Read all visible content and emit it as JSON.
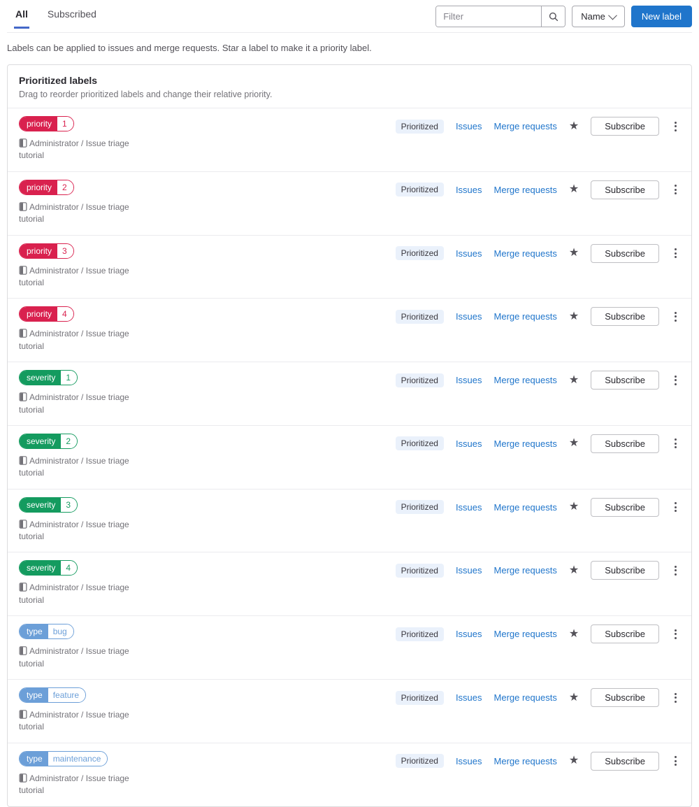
{
  "tabs": {
    "all": "All",
    "subscribed": "Subscribed"
  },
  "toolbar": {
    "filter_placeholder": "Filter",
    "sort_label": "Name",
    "new_label_button": "New label"
  },
  "description": "Labels can be applied to issues and merge requests. Star a label to make it a priority label.",
  "prioritized_card": {
    "title": "Prioritized labels",
    "subtitle": "Drag to reorder prioritized labels and change their relative priority."
  },
  "row_common": {
    "project": "Administrator / Issue triage tutorial",
    "prioritized_badge": "Prioritized",
    "issues_link": "Issues",
    "merge_requests_link": "Merge requests",
    "subscribe_button": "Subscribe",
    "star_icon": "star-filled",
    "kebab_icon": "ellipsis-vertical"
  },
  "labels": [
    {
      "scope": "priority",
      "value": "1",
      "color": "#d9214e"
    },
    {
      "scope": "priority",
      "value": "2",
      "color": "#d9214e"
    },
    {
      "scope": "priority",
      "value": "3",
      "color": "#d9214e"
    },
    {
      "scope": "priority",
      "value": "4",
      "color": "#d9214e"
    },
    {
      "scope": "severity",
      "value": "1",
      "color": "#149b5f"
    },
    {
      "scope": "severity",
      "value": "2",
      "color": "#149b5f"
    },
    {
      "scope": "severity",
      "value": "3",
      "color": "#149b5f"
    },
    {
      "scope": "severity",
      "value": "4",
      "color": "#149b5f"
    },
    {
      "scope": "type",
      "value": "bug",
      "color": "#6c9fd8"
    },
    {
      "scope": "type",
      "value": "feature",
      "color": "#6c9fd8"
    },
    {
      "scope": "type",
      "value": "maintenance",
      "color": "#6c9fd8"
    }
  ],
  "colors": {
    "accent_blue": "#1f75cb",
    "tab_underline": "#4468c8",
    "priority_red": "#d9214e",
    "severity_green": "#149b5f",
    "type_blue": "#6c9fd8",
    "prioritized_badge_bg": "#eaf1fb"
  }
}
